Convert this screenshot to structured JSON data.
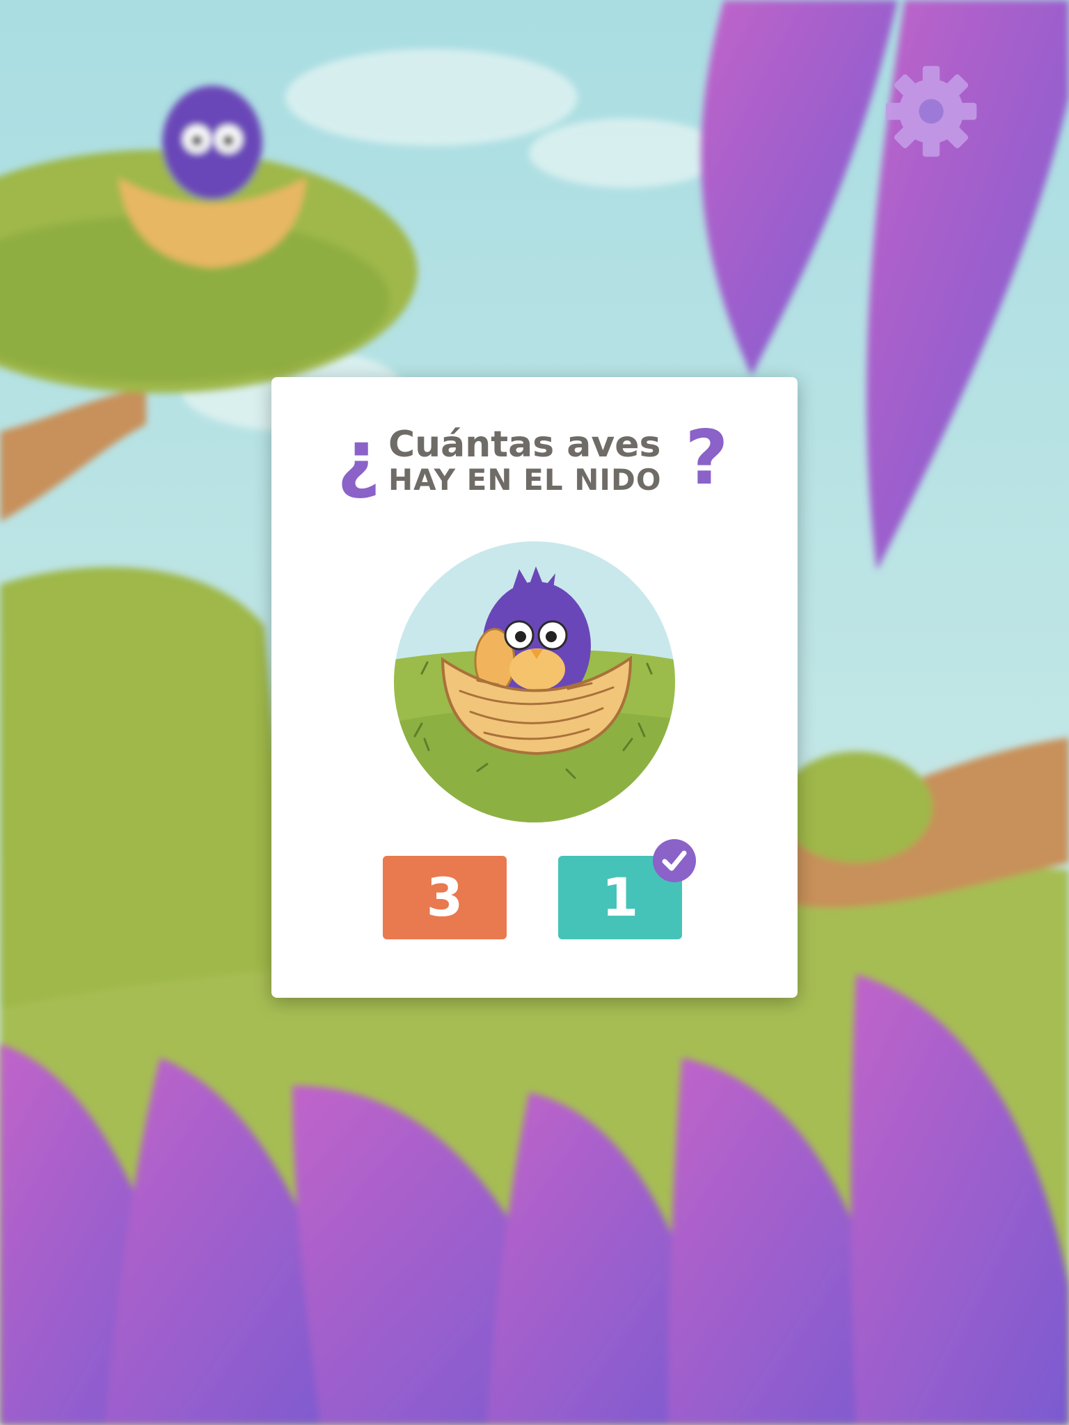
{
  "colors": {
    "sky": "#bfe3e6",
    "foliage_green": "#9fb84a",
    "leaf_purple": "#9a5ad0",
    "branch_brown": "#c8905a",
    "question_purple": "#8a62c8",
    "question_gray": "#6f6b66",
    "answer_wrong": "#e9794f",
    "answer_correct": "#46c3b8",
    "badge": "#8a62c8"
  },
  "settings": {
    "icon": "gear-icon"
  },
  "question": {
    "open_mark": "¿",
    "line1": "Cuántas aves",
    "line2": "HAY EN EL NIDO",
    "close_mark": "?"
  },
  "picture": {
    "subject": "bird-in-nest"
  },
  "answers": [
    {
      "label": "3",
      "state": "wrong"
    },
    {
      "label": "1",
      "state": "correct",
      "badge_icon": "check-icon"
    }
  ]
}
